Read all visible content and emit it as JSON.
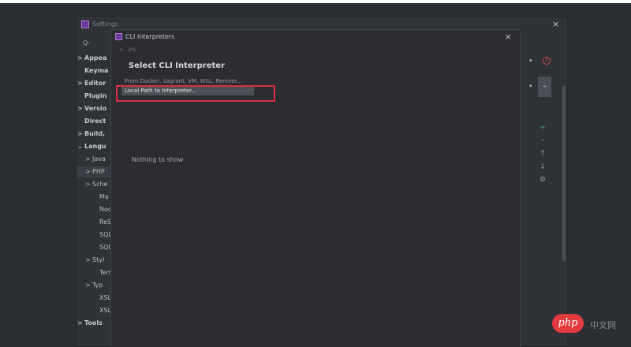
{
  "settings": {
    "title": "Settings",
    "close": "×",
    "search_icon": "Q-",
    "tree": [
      {
        "arrow": ">",
        "label": "Appea",
        "bold": true
      },
      {
        "arrow": "",
        "label": "Keyma",
        "bold": true
      },
      {
        "arrow": ">",
        "label": "Editor",
        "bold": true
      },
      {
        "arrow": "",
        "label": "Plugin",
        "bold": true
      },
      {
        "arrow": ">",
        "label": "Versio",
        "bold": true
      },
      {
        "arrow": "",
        "label": "Direct",
        "bold": true
      },
      {
        "arrow": ">",
        "label": "Build,",
        "bold": true
      },
      {
        "arrow": "⌄",
        "label": "Langu",
        "bold": true
      },
      {
        "arrow": ">",
        "label": "Java",
        "bold": false,
        "indent": 1
      },
      {
        "arrow": ">",
        "label": "PHP",
        "bold": false,
        "indent": 1,
        "selected": true
      },
      {
        "arrow": ">",
        "label": "Sche",
        "bold": false,
        "indent": 1
      },
      {
        "arrow": "",
        "label": "Ma",
        "bold": false,
        "indent": 2
      },
      {
        "arrow": "",
        "label": "Noc",
        "bold": false,
        "indent": 2
      },
      {
        "arrow": "",
        "label": "ReS",
        "bold": false,
        "indent": 2
      },
      {
        "arrow": "",
        "label": "SQL",
        "bold": false,
        "indent": 2
      },
      {
        "arrow": "",
        "label": "SQL",
        "bold": false,
        "indent": 2
      },
      {
        "arrow": ">",
        "label": "Styl",
        "bold": false,
        "indent": 1
      },
      {
        "arrow": "",
        "label": "Tem",
        "bold": false,
        "indent": 2
      },
      {
        "arrow": ">",
        "label": "Typ",
        "bold": false,
        "indent": 1
      },
      {
        "arrow": "",
        "label": "XSL",
        "bold": false,
        "indent": 2
      },
      {
        "arrow": "",
        "label": "XSL",
        "bold": false,
        "indent": 2
      },
      {
        "arrow": ">",
        "label": "Tools",
        "bold": true
      }
    ],
    "right": {
      "dropdown_arrow": "▾",
      "help": "?",
      "remove": "–",
      "tools": [
        "+",
        "–",
        "↑",
        "↓",
        "⚙"
      ]
    }
  },
  "cli_dialog": {
    "title": "CLI Interpreters",
    "close": "×",
    "toolbar": "+ – 0%",
    "empty_text": "Nothing to show"
  },
  "popup": {
    "title": "Select CLI Interpreter",
    "items": [
      "From Docker, Vagrant, VM, WSL, Remote...",
      "Local Path to Interpreter..."
    ]
  },
  "watermark": {
    "badge": "php",
    "text": "中文网"
  }
}
